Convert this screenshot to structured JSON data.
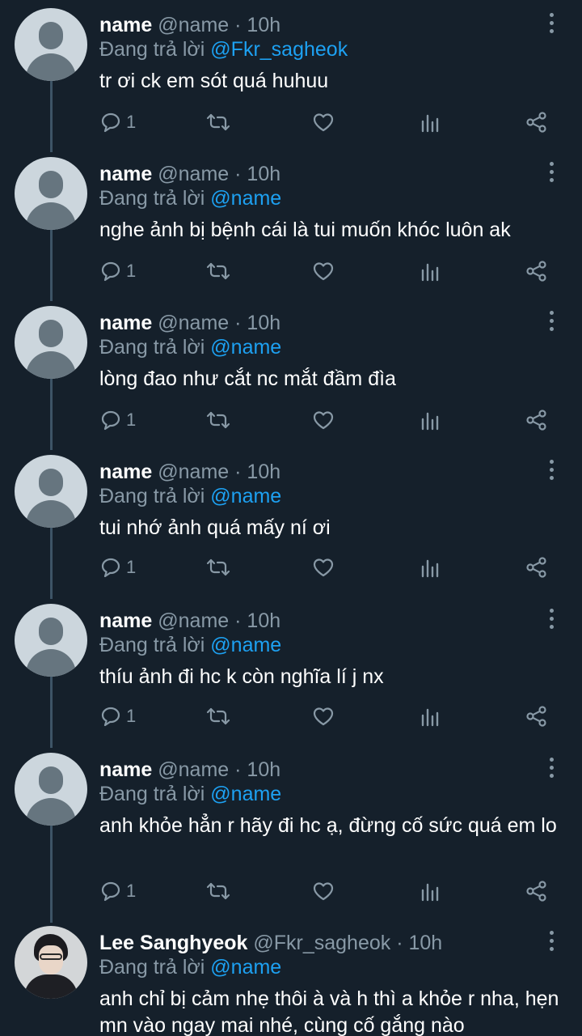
{
  "reply_prefix": "Đang trả lời",
  "tweets": [
    {
      "name": "name",
      "handle": "@name",
      "dot": "·",
      "time": "10h",
      "reply_to": "@Fkr_sagheok",
      "text": "tr ơi ck em sót quá huhuu",
      "reply_count": "1"
    },
    {
      "name": "name",
      "handle": "@name",
      "dot": "·",
      "time": "10h",
      "reply_to": "@name",
      "text": "nghe ảnh bị bệnh cái là tui muốn khóc luôn ak",
      "reply_count": "1"
    },
    {
      "name": "name",
      "handle": "@name",
      "dot": "·",
      "time": "10h",
      "reply_to": "@name",
      "text": "lòng đao như cắt nc mắt đầm đìa",
      "reply_count": "1"
    },
    {
      "name": "name",
      "handle": "@name",
      "dot": "·",
      "time": "10h",
      "reply_to": "@name",
      "text": "tui nhớ ảnh quá mấy ní ơi",
      "reply_count": "1"
    },
    {
      "name": "name",
      "handle": "@name",
      "dot": "·",
      "time": "10h",
      "reply_to": "@name",
      "text": "thíu ảnh đi hc k còn nghĩa lí j nx",
      "reply_count": "1"
    },
    {
      "name": "name",
      "handle": "@name",
      "dot": "·",
      "time": "10h",
      "reply_to": "@name",
      "text": "anh khỏe hẳn r hãy đi hc ạ, đừng cố sức quá em lo",
      "reply_count": "1"
    },
    {
      "name": "Lee Sanghyeok",
      "handle": "@Fkr_sagheok",
      "dot": "·",
      "time": "10h",
      "reply_to": "@name",
      "text": "anh chỉ bị cảm nhẹ thôi à và h thì a khỏe r nha, hẹn mn vào ngay mai nhé, cùng cố gắng nào"
    }
  ],
  "icons": {
    "reply": "reply-icon",
    "retweet": "retweet-icon",
    "like": "heart-icon",
    "analytics": "analytics-icon",
    "share": "share-icon",
    "more": "more-vertical-icon"
  },
  "colors": {
    "background": "#15202b",
    "secondary_text": "#8899a6",
    "mention": "#1da1f2",
    "thread_line": "#3d5466"
  }
}
